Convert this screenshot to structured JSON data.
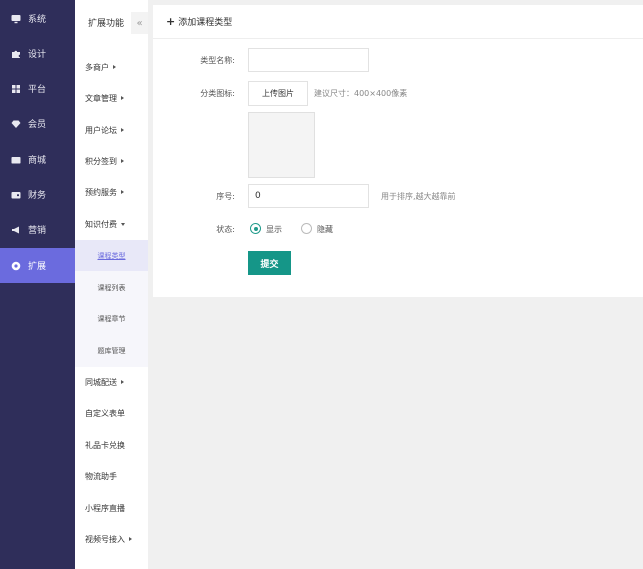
{
  "colors": {
    "nav_bg": "#2f2e5a",
    "nav_active": "#6b6bde",
    "accent_submit": "#159688",
    "radio_on": "#1f9a8a"
  },
  "main_nav": [
    {
      "label": "系统",
      "icon": "monitor-icon"
    },
    {
      "label": "设计",
      "icon": "puzzle-icon"
    },
    {
      "label": "平台",
      "icon": "grid-icon"
    },
    {
      "label": "会员",
      "icon": "diamond-icon"
    },
    {
      "label": "商城",
      "icon": "mail-icon"
    },
    {
      "label": "财务",
      "icon": "wallet-icon"
    },
    {
      "label": "营销",
      "icon": "megaphone-icon"
    },
    {
      "label": "扩展",
      "icon": "cloud-icon",
      "active": true
    }
  ],
  "sub_nav": {
    "title": "扩展功能",
    "collapse": "«",
    "items_top": [
      "多商户",
      "文章管理",
      "用户论坛",
      "积分签到",
      "预约服务",
      "知识付费"
    ],
    "knowledge_children": [
      "课程类型",
      "课程列表",
      "课程章节",
      "题库管理"
    ],
    "items_bottom": [
      "同城配送",
      "自定义表单",
      "礼品卡兑换",
      "物流助手",
      "小程序直播",
      "视频号接入"
    ]
  },
  "form": {
    "header_title": "添加课程类型",
    "name_label": "类型名称:",
    "name_value": "",
    "icon_label": "分类图标:",
    "upload_button": "上传图片",
    "upload_hint": "建议尺寸：400×400像素",
    "order_label": "序号:",
    "order_value": "0",
    "order_hint": "用于排序,越大越靠前",
    "status_label": "状态:",
    "status_options": [
      {
        "label": "显示",
        "checked": true
      },
      {
        "label": "隐藏",
        "checked": false
      }
    ],
    "submit": "提交"
  }
}
